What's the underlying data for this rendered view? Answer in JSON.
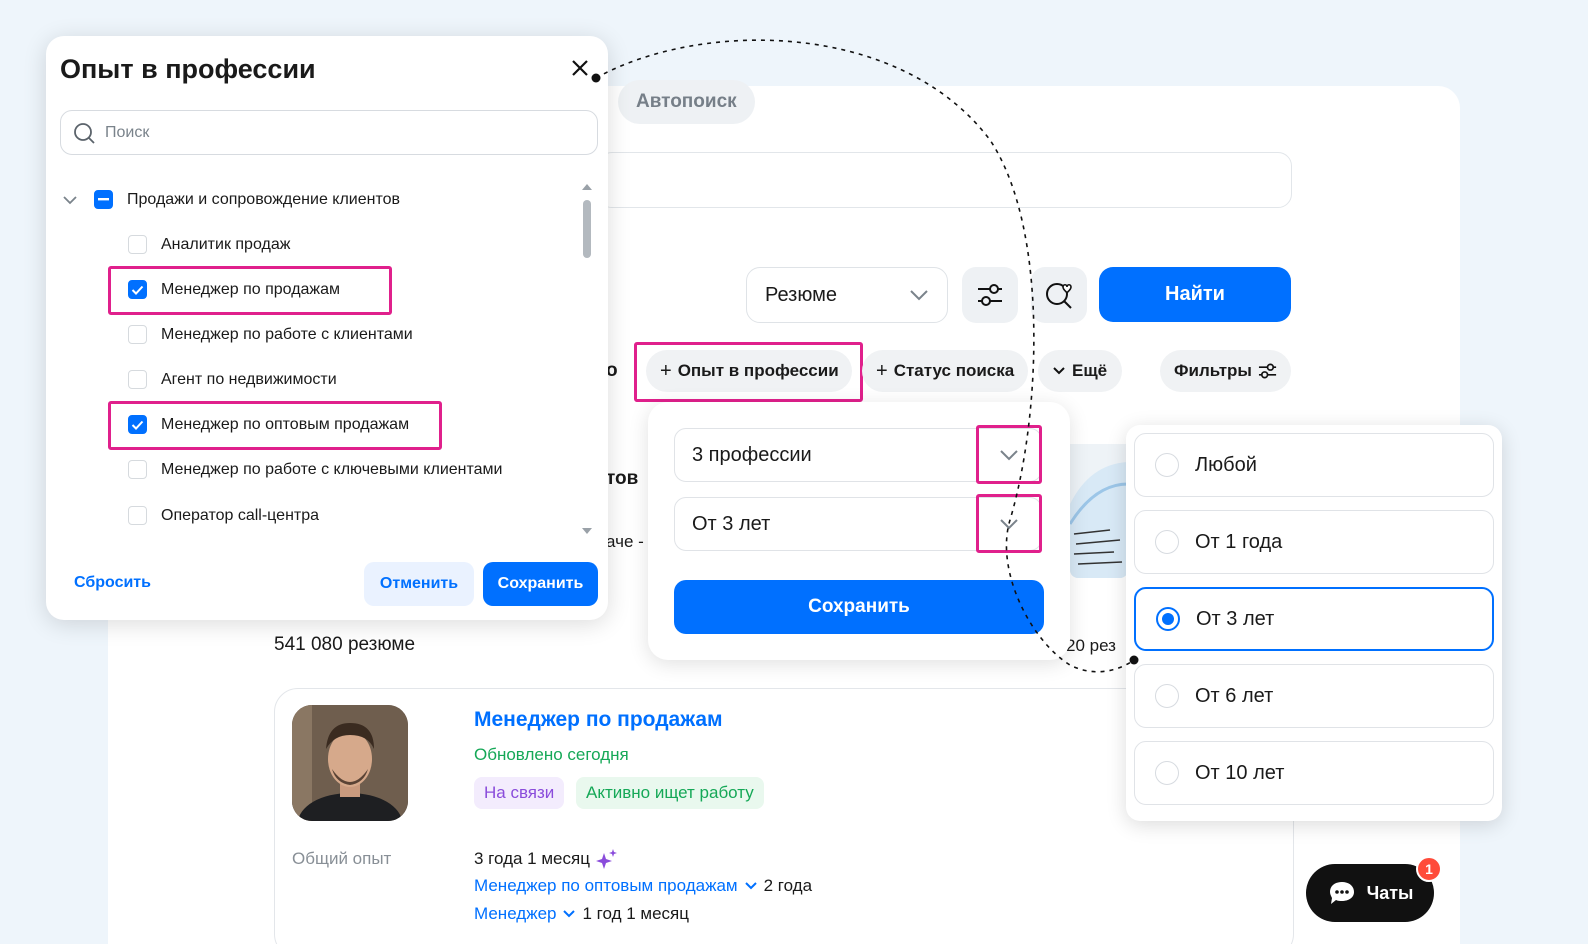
{
  "top": {
    "autosearch_label": "Автопоиск",
    "type_select_value": "Резюме",
    "find_button": "Найти"
  },
  "chips": {
    "cut_left": "о",
    "experience": "Опыт в профессии",
    "status": "Статус поиска",
    "more": "Ещё",
    "filters": "Фильтры"
  },
  "hidden_fragments": {
    "tov": "тов",
    "ache": "аче -"
  },
  "experience_dropdown": {
    "professions_value": "3 профессии",
    "years_value": "От 3 лет",
    "save_button": "Сохранить"
  },
  "modal": {
    "title": "Опыт в профессии",
    "search_placeholder": "Поиск",
    "group": {
      "label": "Продажи и сопровождение клиентов",
      "state": "partial"
    },
    "items": [
      {
        "label": "Аналитик продаж",
        "checked": false
      },
      {
        "label": "Менеджер по продажам",
        "checked": true
      },
      {
        "label": "Менеджер по работе с клиентами",
        "checked": false
      },
      {
        "label": "Агент по недвижимости",
        "checked": false
      },
      {
        "label": "Менеджер по оптовым продажам",
        "checked": true
      },
      {
        "label": "Менеджер по работе с ключевыми клиентами",
        "checked": false
      },
      {
        "label": "Оператор call-центра",
        "checked": false
      }
    ],
    "reset_button": "Сбросить",
    "cancel_button": "Отменить",
    "save_button": "Сохранить"
  },
  "experience_options": [
    {
      "label": "Любой",
      "selected": false
    },
    {
      "label": "От 1 года",
      "selected": false
    },
    {
      "label": "От 3 лет",
      "selected": true
    },
    {
      "label": "От 6 лет",
      "selected": false
    },
    {
      "label": "От 10 лет",
      "selected": false
    }
  ],
  "results": {
    "count": "541 080 резюме",
    "count_right": "20 рез"
  },
  "resume": {
    "title": "Менеджер по продажам",
    "updated": "Обновлено сегодня",
    "badge_online": "На связи",
    "badge_active": "Активно ищет работу",
    "total_label": "Общий опыт",
    "total_value": "3 года 1 месяц",
    "exp1_title": "Менеджер по оптовым продажам",
    "exp1_duration": "2 года",
    "exp2_title": "Менеджер",
    "exp2_duration": "1 год  1 месяц"
  },
  "chats": {
    "label": "Чаты",
    "badge": "1"
  },
  "colors": {
    "accent": "#0070ff",
    "highlight": "#e0208c",
    "success": "#15a857"
  }
}
